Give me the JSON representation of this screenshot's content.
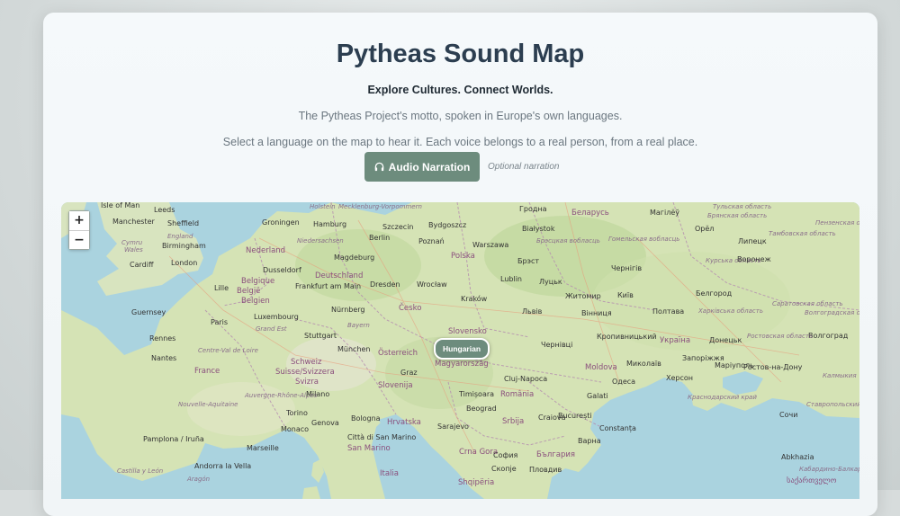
{
  "header": {
    "title": "Pytheas Sound Map",
    "tagline": "Explore Cultures. Connect Worlds.",
    "description": "The Pytheas Project's motto, spoken in Europe's own languages.",
    "instruction": "Select a language on the map to hear it. Each voice belongs to a real person, from a real place."
  },
  "narration": {
    "button_label": "Audio Narration",
    "icon": "headphones-icon",
    "note": "Optional narration"
  },
  "map": {
    "zoom_in": "+",
    "zoom_out": "−",
    "marker": {
      "label": "Hungarian",
      "color": "#6d8c7d"
    },
    "labels": [
      {
        "text": "Isle of Man",
        "kind": "place"
      },
      {
        "text": "Leeds",
        "kind": "place"
      },
      {
        "text": "Manchester",
        "kind": "place"
      },
      {
        "text": "Sheffield",
        "kind": "place"
      },
      {
        "text": "Cymru",
        "kind": "region"
      },
      {
        "text": "England",
        "kind": "region"
      },
      {
        "text": "Wales",
        "kind": "region"
      },
      {
        "text": "Birmingham",
        "kind": "place"
      },
      {
        "text": "Cardiff",
        "kind": "place"
      },
      {
        "text": "London",
        "kind": "place"
      },
      {
        "text": "Guernsey",
        "kind": "place"
      },
      {
        "text": "Lille",
        "kind": "place"
      },
      {
        "text": "Nederland",
        "kind": "country"
      },
      {
        "text": "Groningen",
        "kind": "place"
      },
      {
        "text": "Hamburg",
        "kind": "place"
      },
      {
        "text": "Holstein",
        "kind": "region"
      },
      {
        "text": "Mecklenburg-Vorpommern",
        "kind": "region"
      },
      {
        "text": "Szczecin",
        "kind": "place"
      },
      {
        "text": "Bydgoszcz",
        "kind": "place"
      },
      {
        "text": "Гродна",
        "kind": "place"
      },
      {
        "text": "Беларусь",
        "kind": "country"
      },
      {
        "text": "Магілёў",
        "kind": "place"
      },
      {
        "text": "Тульская область",
        "kind": "region"
      },
      {
        "text": "Niedersachsen",
        "kind": "region"
      },
      {
        "text": "Berlin",
        "kind": "place"
      },
      {
        "text": "Poznań",
        "kind": "place"
      },
      {
        "text": "Warszawa",
        "kind": "place"
      },
      {
        "text": "Białystok",
        "kind": "place"
      },
      {
        "text": "Брэсцкая вобласць",
        "kind": "region"
      },
      {
        "text": "Гомельская вобласць",
        "kind": "region"
      },
      {
        "text": "Брянская область",
        "kind": "region"
      },
      {
        "text": "Орёл",
        "kind": "place"
      },
      {
        "text": "Липецк",
        "kind": "place"
      },
      {
        "text": "Тамбовская область",
        "kind": "region"
      },
      {
        "text": "Пензенская область",
        "kind": "region"
      },
      {
        "text": "Dusseldorf",
        "kind": "place"
      },
      {
        "text": "Magdeburg",
        "kind": "place"
      },
      {
        "text": "Polska",
        "kind": "country"
      },
      {
        "text": "Брэст",
        "kind": "place"
      },
      {
        "text": "Чернігів",
        "kind": "place"
      },
      {
        "text": "Курська область",
        "kind": "region"
      },
      {
        "text": "Воронеж",
        "kind": "place"
      },
      {
        "text": "Belgique",
        "kind": "country"
      },
      {
        "text": "België",
        "kind": "country"
      },
      {
        "text": "Belgien",
        "kind": "country"
      },
      {
        "text": "Frankfurt am Main",
        "kind": "place"
      },
      {
        "text": "Deutschland",
        "kind": "country"
      },
      {
        "text": "Dresden",
        "kind": "place"
      },
      {
        "text": "Wrocław",
        "kind": "place"
      },
      {
        "text": "Lublin",
        "kind": "place"
      },
      {
        "text": "Луцьк",
        "kind": "place"
      },
      {
        "text": "Житомир",
        "kind": "place"
      },
      {
        "text": "Київ",
        "kind": "place"
      },
      {
        "text": "Белгород",
        "kind": "place"
      },
      {
        "text": "Саратовская область",
        "kind": "region"
      },
      {
        "text": "Luxembourg",
        "kind": "place"
      },
      {
        "text": "Nürnberg",
        "kind": "place"
      },
      {
        "text": "Česko",
        "kind": "country"
      },
      {
        "text": "Kraków",
        "kind": "place"
      },
      {
        "text": "Львів",
        "kind": "place"
      },
      {
        "text": "Вінниця",
        "kind": "place"
      },
      {
        "text": "Полтава",
        "kind": "place"
      },
      {
        "text": "Харківська область",
        "kind": "region"
      },
      {
        "text": "Волгоградская область",
        "kind": "region"
      },
      {
        "text": "Paris",
        "kind": "place"
      },
      {
        "text": "Grand Est",
        "kind": "region"
      },
      {
        "text": "Bayern",
        "kind": "region"
      },
      {
        "text": "Slovensko",
        "kind": "country"
      },
      {
        "text": "Stuttgart",
        "kind": "place"
      },
      {
        "text": "Україна",
        "kind": "country"
      },
      {
        "text": "Донецьк",
        "kind": "place"
      },
      {
        "text": "Волгоград",
        "kind": "place"
      },
      {
        "text": "Rennes",
        "kind": "place"
      },
      {
        "text": "München",
        "kind": "place"
      },
      {
        "text": "Österreich",
        "kind": "country"
      },
      {
        "text": "Чернівці",
        "kind": "place"
      },
      {
        "text": "Кропивницький",
        "kind": "place"
      },
      {
        "text": "Ростовская область",
        "kind": "region"
      },
      {
        "text": "Nantes",
        "kind": "place"
      },
      {
        "text": "Centre-Val de Loire",
        "kind": "region"
      },
      {
        "text": "Schweiz",
        "kind": "country"
      },
      {
        "text": "Magyarország",
        "kind": "country"
      },
      {
        "text": "Moldova",
        "kind": "country"
      },
      {
        "text": "Миколаїв",
        "kind": "place"
      },
      {
        "text": "Запоріжжя",
        "kind": "place"
      },
      {
        "text": "Маріуполь",
        "kind": "place"
      },
      {
        "text": "Ростов-на-Дону",
        "kind": "place"
      },
      {
        "text": "France",
        "kind": "country"
      },
      {
        "text": "Suisse/Svizzera",
        "kind": "country"
      },
      {
        "text": "Graz",
        "kind": "place"
      },
      {
        "text": "Cluj-Napoca",
        "kind": "place"
      },
      {
        "text": "Одеса",
        "kind": "place"
      },
      {
        "text": "Херсон",
        "kind": "place"
      },
      {
        "text": "Калмыкия",
        "kind": "region"
      },
      {
        "text": "Svizra",
        "kind": "country"
      },
      {
        "text": "Slovenija",
        "kind": "country"
      },
      {
        "text": "România",
        "kind": "country"
      },
      {
        "text": "Galati",
        "kind": "place"
      },
      {
        "text": "Краснодарский край",
        "kind": "region"
      },
      {
        "text": "Auvergne-Rhône-Alpes",
        "kind": "region"
      },
      {
        "text": "Milano",
        "kind": "place"
      },
      {
        "text": "Timișoara",
        "kind": "place"
      },
      {
        "text": "Nouvelle-Aquitaine",
        "kind": "region"
      },
      {
        "text": "Beograd",
        "kind": "place"
      },
      {
        "text": "Ставропольский край",
        "kind": "region"
      },
      {
        "text": "Torino",
        "kind": "place"
      },
      {
        "text": "Bologna",
        "kind": "place"
      },
      {
        "text": "Hrvatska",
        "kind": "country"
      },
      {
        "text": "Srbija",
        "kind": "country"
      },
      {
        "text": "Craiova",
        "kind": "place"
      },
      {
        "text": "București",
        "kind": "place"
      },
      {
        "text": "Сочи",
        "kind": "place"
      },
      {
        "text": "Monaco",
        "kind": "place"
      },
      {
        "text": "Genova",
        "kind": "place"
      },
      {
        "text": "Sarajevo",
        "kind": "place"
      },
      {
        "text": "Constanța",
        "kind": "place"
      },
      {
        "text": "Pamplona / Iruña",
        "kind": "place"
      },
      {
        "text": "Città di San Marino",
        "kind": "place"
      },
      {
        "text": "Варна",
        "kind": "place"
      },
      {
        "text": "Marseille",
        "kind": "place"
      },
      {
        "text": "San Marino",
        "kind": "country"
      },
      {
        "text": "Crna Gora",
        "kind": "country"
      },
      {
        "text": "София",
        "kind": "place"
      },
      {
        "text": "България",
        "kind": "country"
      },
      {
        "text": "Abkhazia",
        "kind": "place"
      },
      {
        "text": "Andorra la Vella",
        "kind": "place"
      },
      {
        "text": "Italia",
        "kind": "country"
      },
      {
        "text": "Скопје",
        "kind": "place"
      },
      {
        "text": "Пловдив",
        "kind": "place"
      },
      {
        "text": "Castilla y León",
        "kind": "region"
      },
      {
        "text": "Aragón",
        "kind": "region"
      },
      {
        "text": "Shqipëria",
        "kind": "country"
      },
      {
        "text": "Кабардино-Балкария",
        "kind": "region"
      },
      {
        "text": "საქართველო",
        "kind": "country"
      }
    ]
  }
}
